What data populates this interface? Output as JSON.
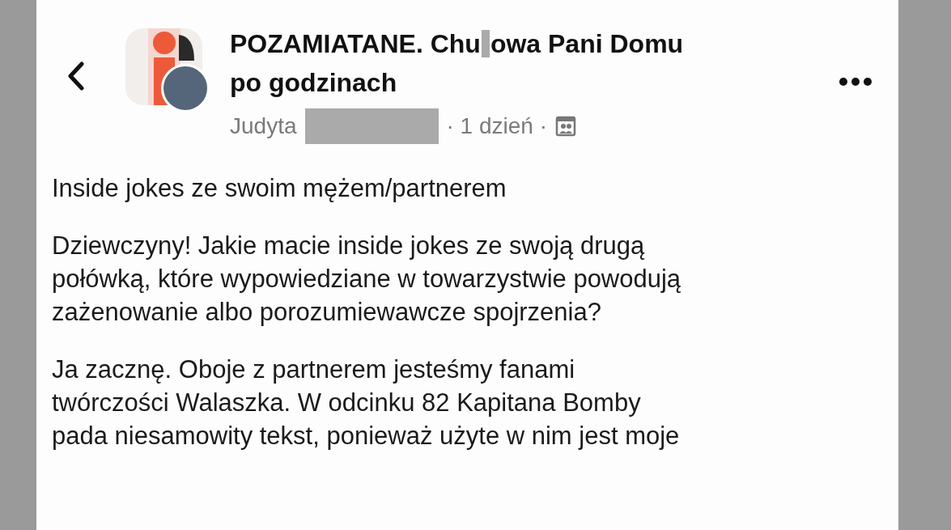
{
  "post": {
    "group_title_parts": [
      "POZAMIATANE. Chu",
      "owa Pani Domu"
    ],
    "group_title_line_2": "po godzinach",
    "author": "Judyta",
    "time": "· 1 dzień ·",
    "paragraphs": [
      [
        "Inside jokes ze swoim mężem/partnerem"
      ],
      [
        "Dziewczyny! Jakie macie inside jokes ze swoją drugą",
        "połówką, które wypowiedziane w towarzystwie powodują",
        "zażenowanie albo porozumiewawcze spojrzenia?"
      ],
      [
        "Ja zacznę. Oboje z partnerem jesteśmy fanami",
        "twórczości Walaszka. W odcinku 82 Kapitana Bomby",
        "pada niesamowity tekst, ponieważ użyte w nim jest moje"
      ]
    ]
  }
}
